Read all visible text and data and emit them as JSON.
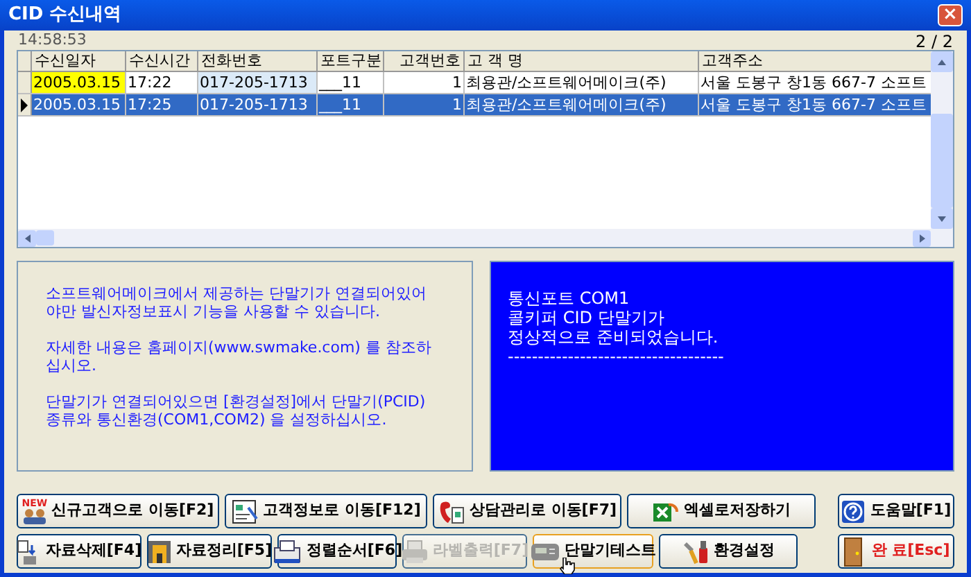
{
  "window": {
    "title": "CID 수신내역",
    "close": "×"
  },
  "clock": "14:58:53",
  "page_counter": "2 / 2",
  "table": {
    "columns": [
      "수신일자",
      "수신시간",
      "전화번호",
      "포트구분",
      "고객번호",
      "고 객 명",
      "고객주소"
    ],
    "rows": [
      {
        "selected": false,
        "date_highlight": true,
        "cells": [
          "2005.03.15",
          "17:22",
          "017-205-1713",
          "___11",
          "1",
          "최용관/소프트웨어메이크(주)",
          "서울 도봉구 창1동 667-7 소프트"
        ]
      },
      {
        "selected": true,
        "date_highlight": false,
        "cells": [
          "2005.03.15",
          "17:25",
          "017-205-1713",
          "___11",
          "1",
          "최용관/소프트웨어메이크(주)",
          "서울 도봉구 창1동 667-7 소프트"
        ]
      }
    ]
  },
  "info_panel": {
    "paragraphs": [
      "소프트웨어메이크에서 제공하는 단말기가 연결되어있어야만 발신자정보표시 기능을 사용할 수 있습니다.",
      "자세한 내용은 홈페이지(www.swmake.com) 를 참조하십시오.",
      "단말기가 연결되어있으면 [환경설정]에서 단말기(PCID)종류와 통신환경(COM1,COM2) 을 설정하십시오."
    ]
  },
  "status_panel": {
    "lines": [
      "통신포트 COM1",
      "콜키퍼 CID 단말기가",
      "정상적으로 준비되었습니다.",
      "------------------------------------"
    ]
  },
  "buttons": [
    [
      {
        "label": "신규고객으로 이동[F2]",
        "badge": "NEW",
        "disabled": false,
        "hovered": false,
        "danger": false
      },
      {
        "label": "고객정보로 이동[F12]",
        "disabled": false,
        "hovered": false,
        "danger": false
      },
      {
        "label": "상담관리로 이동[F7]",
        "disabled": false,
        "hovered": false,
        "danger": false
      },
      {
        "label": "엑셀로저장하기",
        "disabled": false,
        "hovered": false,
        "danger": false
      },
      {
        "label": "도움말[F1]",
        "disabled": false,
        "hovered": false,
        "danger": false
      }
    ],
    [
      {
        "label": "자료삭제[F4]",
        "disabled": false,
        "hovered": false,
        "danger": false
      },
      {
        "label": "자료정리[F5]",
        "disabled": false,
        "hovered": false,
        "danger": false
      },
      {
        "label": "정렬순서[F6]",
        "disabled": false,
        "hovered": false,
        "danger": false
      },
      {
        "label": "라벨출력[F7]",
        "disabled": true,
        "hovered": false,
        "danger": false
      },
      {
        "label": "단말기테스트",
        "disabled": false,
        "hovered": true,
        "danger": false
      },
      {
        "label": "환경설정",
        "disabled": false,
        "hovered": false,
        "danger": false
      },
      {
        "label": "완 료[Esc]",
        "disabled": false,
        "hovered": false,
        "danger": true
      }
    ]
  ]
}
